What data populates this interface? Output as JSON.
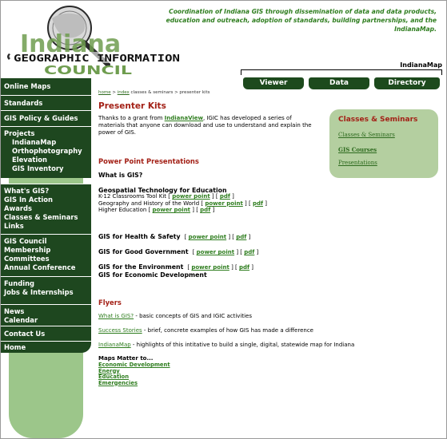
{
  "header": {
    "logo_word": "Indiana",
    "logo_banner": "GEOGRAPHIC INFORMATION",
    "logo_council": "COUNCIL",
    "tagline": "Coordination of Indiana GIS through dissemination of data and data products, education and outreach, adoption of standards, building partnerships, and the IndianaMap.",
    "indianamap_label": "IndianaMap"
  },
  "tabs": [
    "Viewer",
    "Data",
    "Directory"
  ],
  "sidebar": {
    "groups": [
      {
        "items": [
          {
            "label": "Online Maps",
            "sub": false
          }
        ]
      },
      {
        "items": [
          {
            "label": "Standards",
            "sub": false
          }
        ]
      },
      {
        "items": [
          {
            "label": "GIS Policy & Guides",
            "sub": false
          }
        ]
      },
      {
        "items": [
          {
            "label": "Projects",
            "sub": false
          },
          {
            "label": "IndianaMap",
            "sub": true
          },
          {
            "label": "Orthophotography",
            "sub": true
          },
          {
            "label": "Elevation",
            "sub": true
          },
          {
            "label": "GIS Inventory",
            "sub": true
          }
        ]
      },
      {
        "items": [
          {
            "label": "What's GIS?",
            "sub": false
          },
          {
            "label": "GIS In Action",
            "sub": false
          },
          {
            "label": "Awards",
            "sub": false
          },
          {
            "label": "Classes & Seminars",
            "sub": false
          },
          {
            "label": "Links",
            "sub": false
          }
        ]
      },
      {
        "items": [
          {
            "label": "GIS Council",
            "sub": false
          },
          {
            "label": "Membership",
            "sub": false
          },
          {
            "label": "Committees",
            "sub": false
          },
          {
            "label": "Annual Conference",
            "sub": false
          }
        ]
      },
      {
        "items": [
          {
            "label": "Funding",
            "sub": false
          },
          {
            "label": "Jobs & Internships",
            "sub": false
          }
        ]
      },
      {
        "items": [
          {
            "label": "News",
            "sub": false
          },
          {
            "label": "Calendar",
            "sub": false
          }
        ]
      },
      {
        "items": [
          {
            "label": "Contact Us",
            "sub": false
          }
        ]
      },
      {
        "items": [
          {
            "label": "Home",
            "sub": false
          }
        ]
      }
    ]
  },
  "breadcrumb": {
    "home": "home",
    "sep1": " > ",
    "index": "index",
    "rest": " classes & seminars > presenter kits"
  },
  "main": {
    "title": "Presenter Kits",
    "intro_pre": "Thanks to a grant from ",
    "intro_link": "IndianaView",
    "intro_post": ", IGIC has developed a series of materials that anyone can download and use to understand and explain the power of GIS.",
    "ppt_heading": "Power Point Presentations",
    "what_is_gis": "What is GIS?",
    "geo_tech": "Geospatial Technology for Education",
    "k12": "K-12 Classrooms Tool Kit",
    "geo_history": "Geography and History of the World",
    "higher_ed": "Higher Education",
    "power_point": "power point",
    "pdf": "pdf",
    "health": "GIS for Health & Safety",
    "good_gov": "GIS for Good Government",
    "environment": "GIS for the Environment",
    "econ_dev": "GIS for Economic Development",
    "flyers_heading": "Flyers",
    "flyer1_link": "What is GIS?",
    "flyer1_text": " - basic concepts of GIS and IGIC activities",
    "flyer2_link": "Success Stories",
    "flyer2_text": " - brief, concrete examples of how GIS has made a difference",
    "flyer3_link": "IndianaMap",
    "flyer3_text": " - highlights of this intitative to build a single, digital, statewide map for Indiana",
    "maps_matter": "Maps Matter to...",
    "mm_links": [
      "Economic Development",
      "Energy",
      "Education",
      "Emergencies"
    ]
  },
  "rightbox": {
    "title": "Classes & Seminars",
    "links": [
      "Classes & Seminars",
      "GIS Courses",
      "Presentations"
    ]
  },
  "colors": {
    "dark_green": "#1e471f",
    "light_green": "#9cc68a",
    "red": "#a32016",
    "link_green": "#2e7d1e"
  }
}
